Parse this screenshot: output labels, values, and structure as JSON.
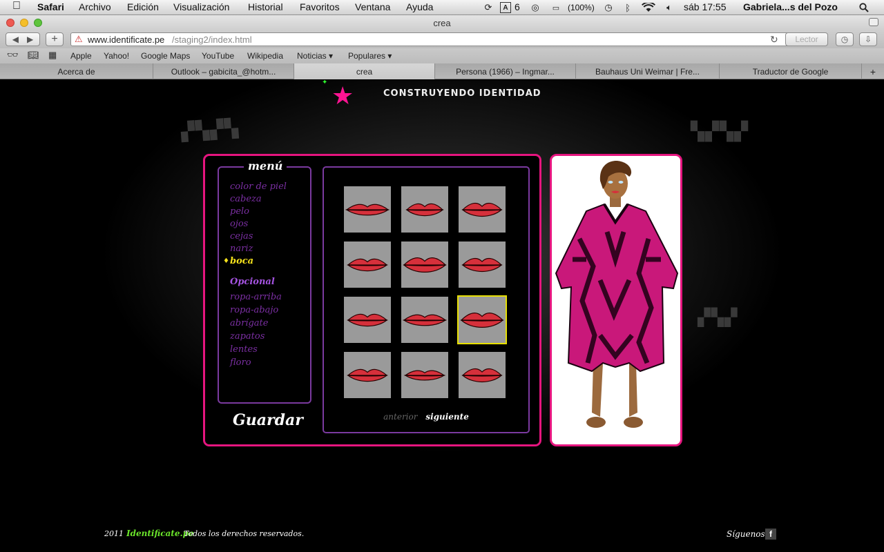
{
  "os_menu": {
    "app": "Safari",
    "items": [
      "Archivo",
      "Edición",
      "Visualización",
      "Historial",
      "Favoritos",
      "Ventana",
      "Ayuda"
    ],
    "status": {
      "adobe_count": "6",
      "battery": "(100%)",
      "clock": "sáb 17:55",
      "user": "Gabriela...s del Pozo"
    }
  },
  "window": {
    "title": "crea"
  },
  "toolbar": {
    "url_domain": "www.identificate.pe",
    "url_path": "/staging2/index.html",
    "reader": "Lector"
  },
  "bookmarks": [
    "Apple",
    "Yahoo!",
    "Google Maps",
    "YouTube",
    "Wikipedia",
    "Noticias ▾",
    "Populares ▾"
  ],
  "tabs": [
    {
      "label": "Acerca de",
      "active": false
    },
    {
      "label": "Outlook – gabicita_@hotm...",
      "active": false
    },
    {
      "label": "crea",
      "active": true
    },
    {
      "label": "Persona (1966) – Ingmar...",
      "active": false
    },
    {
      "label": "Bauhaus Uni Weimar | Fre...",
      "active": false
    },
    {
      "label": "Traductor de Google",
      "active": false
    }
  ],
  "site": {
    "header": "CONSTRUYENDO IDENTIDAD",
    "menu_title": "menú",
    "menu_items": [
      "color de piel",
      "cabeza",
      "pelo",
      "ojos",
      "cejas",
      "nariz",
      "boca"
    ],
    "current_item": "boca",
    "optional_title": "Opcional",
    "optional_items": [
      "ropa-arriba",
      "ropa-abajo",
      "abrígate",
      "zapatos",
      "lentes",
      "floro"
    ],
    "save": "Guardar",
    "pager": {
      "prev": "anterior",
      "next": "siguiente"
    },
    "grid_selected_index": 8,
    "colors": {
      "accent": "#e6157f",
      "menu_purple": "#7b2fa3",
      "highlight": "#f5e21c",
      "lips": "#d6303b",
      "cell": "#9a9a9a"
    }
  },
  "footer": {
    "year": "2011",
    "brand": "Identificate.pe",
    "rights": "Todos los derechos reservados.",
    "follow": "Síguenos",
    "fb": "f"
  }
}
